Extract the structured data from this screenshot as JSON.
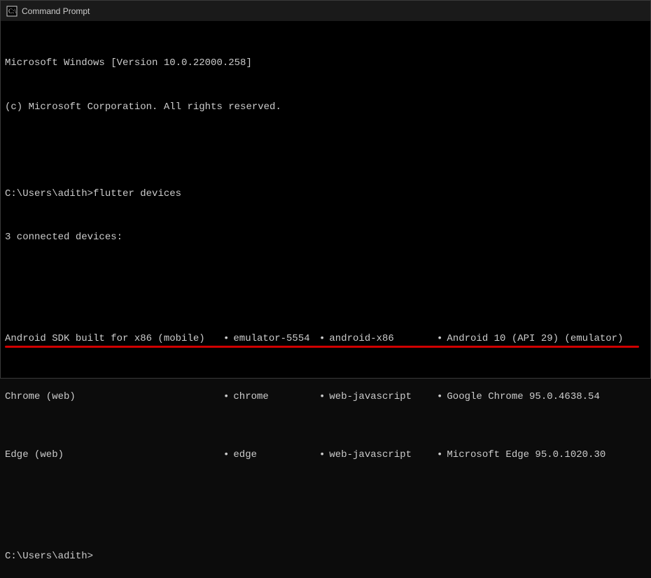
{
  "titlebar": {
    "title": "Command Prompt"
  },
  "terminal": {
    "line1": "Microsoft Windows [Version 10.0.22000.258]",
    "line2": "(c) Microsoft Corporation. All rights reserved.",
    "prompt1": "C:\\Users\\adith>",
    "command1": "flutter devices",
    "connected": "3 connected devices:",
    "devices": [
      {
        "name": "Android SDK built for x86 (mobile)",
        "id": "emulator-5554",
        "platform": "android-x86",
        "version": "Android 10 (API 29) (emulator)"
      },
      {
        "name": "Chrome (web)",
        "id": "chrome",
        "platform": "web-javascript",
        "version": "Google Chrome 95.0.4638.54"
      },
      {
        "name": "Edge (web)",
        "id": "edge",
        "platform": "web-javascript",
        "version": "Microsoft Edge 95.0.1020.30"
      }
    ],
    "prompt2": "C:\\Users\\adith>"
  },
  "annotation": {
    "highlight_color": "#d00000"
  }
}
